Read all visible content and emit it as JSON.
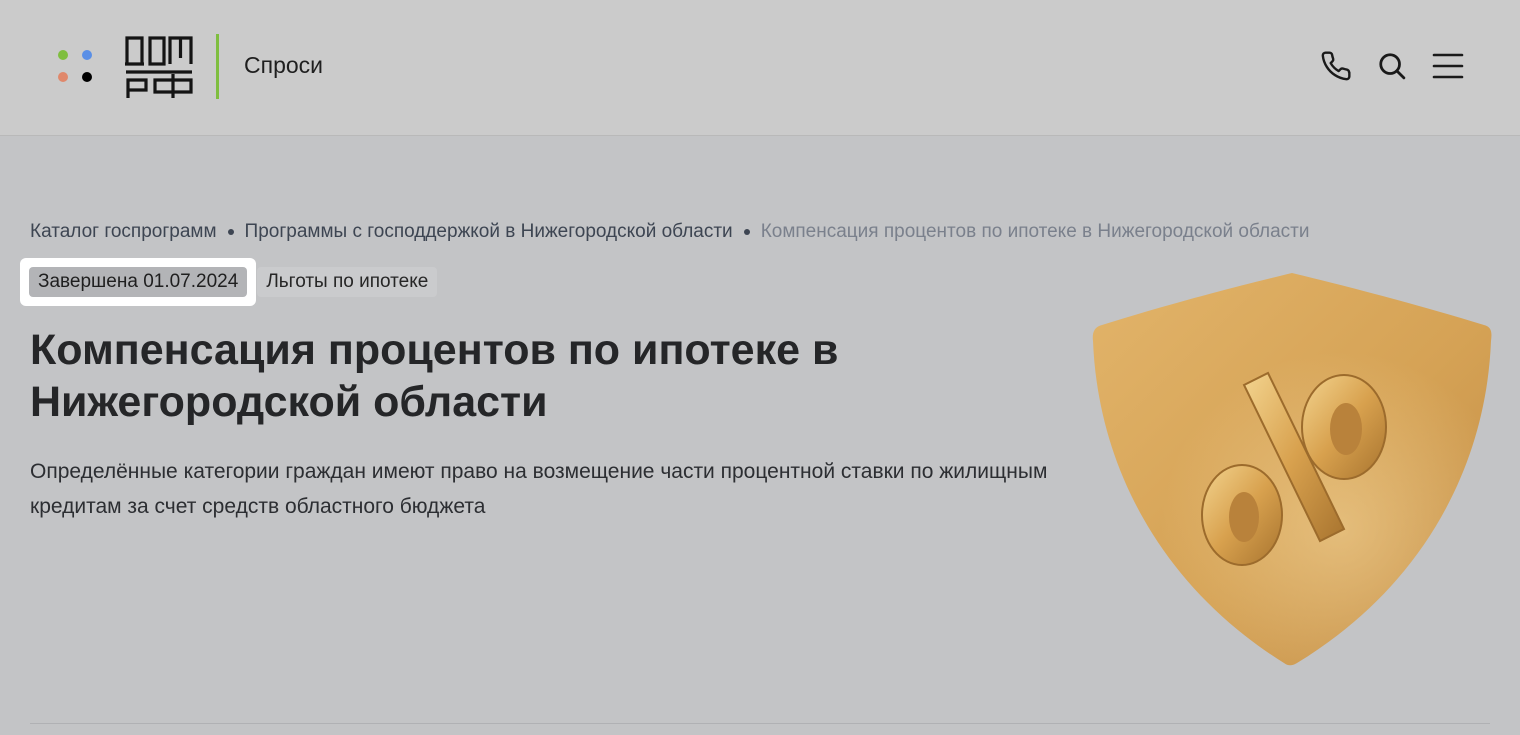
{
  "header": {
    "logo_dot_colors": [
      "#7fbe3f",
      "#5a8fe6",
      "#e0886b",
      "#000000"
    ],
    "logo_divider_color": "#7fbe3f",
    "service_name": "Спроси",
    "icons": [
      "phone-icon",
      "search-icon",
      "menu-icon"
    ]
  },
  "breadcrumb": {
    "items": [
      "Каталог госпрограмм",
      "Программы с господдержкой в Нижегородской области"
    ],
    "current": "Компенсация процентов по ипотеке в Нижегородской области"
  },
  "tags": {
    "status": "Завершена 01.07.2024",
    "category": "Льготы по ипотеке"
  },
  "page": {
    "title": "Компенсация процентов по ипотеке в Нижегородской области",
    "description": "Определённые категории граждан имеют право на возмещение части процентной ставки по жилищным кредитам за счет средств областного бюджета"
  },
  "hero": {
    "icon": "percent-shield-icon",
    "colors": {
      "shield": "#d9a65d",
      "shield_edge": "#c38f47",
      "percent": "#d6a54f"
    }
  }
}
